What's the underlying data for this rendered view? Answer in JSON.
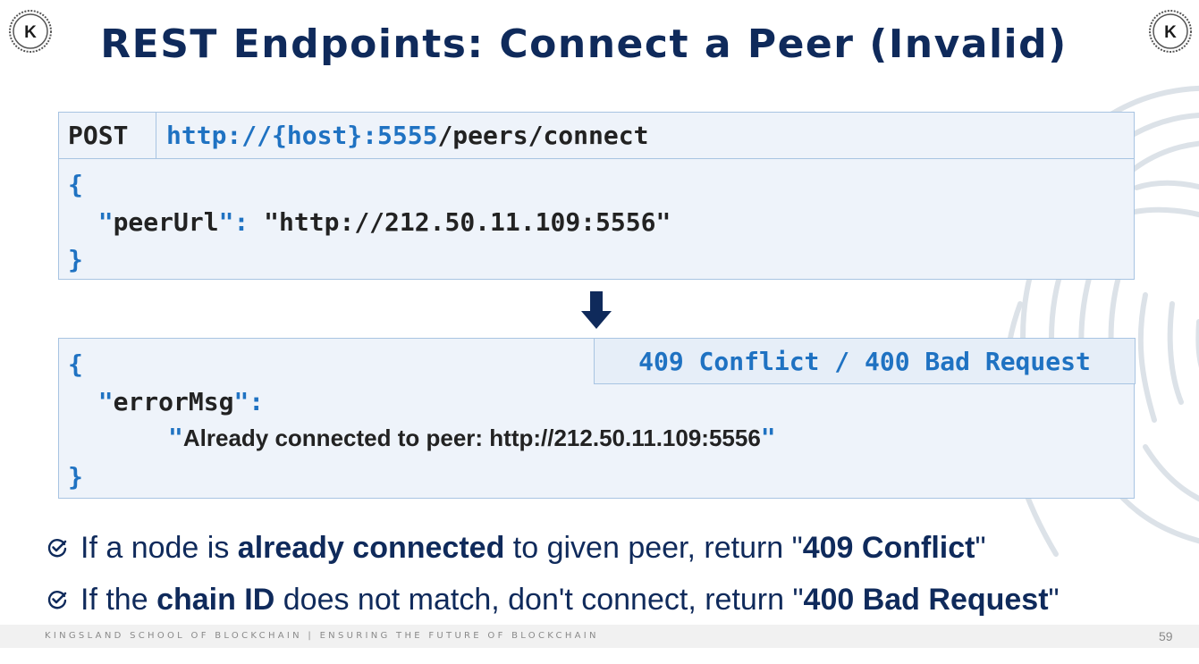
{
  "title": "REST Endpoints: Connect a Peer (Invalid)",
  "logo": {
    "letter": "K"
  },
  "request": {
    "method": "POST",
    "url_base": "http://{host}:5555",
    "url_path": "/peers/connect",
    "open_brace": "{",
    "key_quote_open": "\"",
    "key": "peerUrl",
    "key_quote_close": "\"",
    "separator": ": ",
    "value": "\"http://212.50.11.109:5556\"",
    "close_brace": "}"
  },
  "response": {
    "status": "409 Conflict / 400 Bad Request",
    "open_brace": "{",
    "key": "errorMsg",
    "message": "Already connected to peer: http://212.50.11.109:5556",
    "close_brace": "}"
  },
  "bullets": [
    {
      "pre": "If a node is ",
      "bold1": "already connected",
      "mid": " to given peer, return \"",
      "bold2": "409 Conflict",
      "post": "\""
    },
    {
      "pre": "If the ",
      "bold1": "chain ID",
      "mid": " does not match, don't connect, return \"",
      "bold2": "400 Bad Request",
      "post": "\""
    }
  ],
  "footer": {
    "text": "KINGSLAND SCHOOL OF BLOCKCHAIN | ENSURING THE FUTURE OF BLOCKCHAIN",
    "page_number": "59"
  },
  "colors": {
    "navy": "#0f2a5b",
    "code_blue": "#1f72c2",
    "box_bg": "#eef3fa",
    "box_border": "#a8c4e2"
  }
}
